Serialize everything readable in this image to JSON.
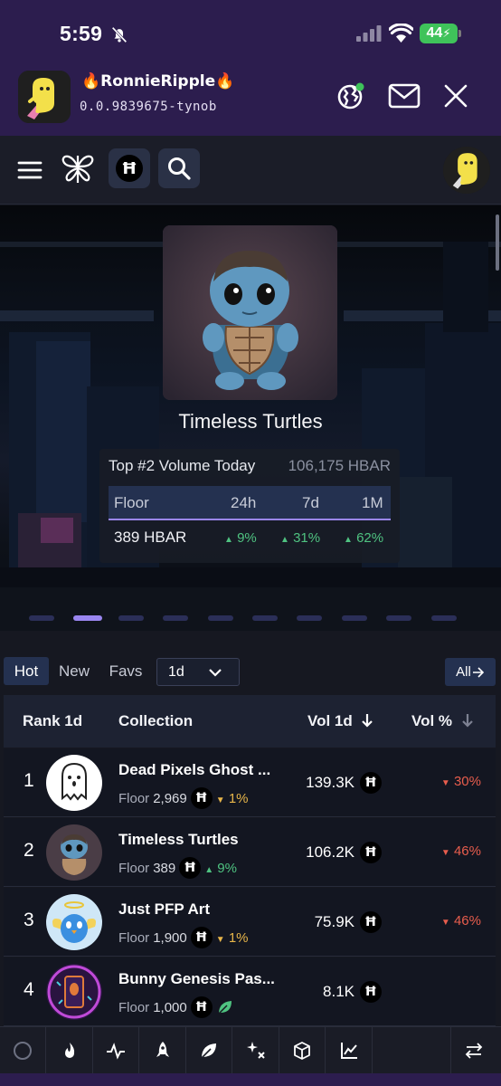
{
  "status": {
    "time": "5:59",
    "battery": "44"
  },
  "wallet": {
    "name": "RonnieRipple",
    "name_prefix": "🔥",
    "name_suffix": "🔥",
    "account_id": "0.0.9839675-tynob"
  },
  "toolbar": {
    "network_symbol": "Ħ"
  },
  "hero": {
    "collection_name": "Timeless Turtles",
    "rank_label": "Top #2 Volume Today",
    "volume": "106,175 HBAR",
    "headers": [
      "Floor",
      "24h",
      "7d",
      "1M"
    ],
    "floor": "389 HBAR",
    "changes": [
      "9%",
      "31%",
      "62%"
    ],
    "carousel_count": 10,
    "carousel_active_index": 1
  },
  "filters": {
    "tabs": [
      "Hot",
      "New",
      "Favs"
    ],
    "active_tab": "Hot",
    "period": "1d",
    "all_label": "All"
  },
  "table": {
    "headers": {
      "rank": "Rank 1d",
      "collection": "Collection",
      "vol": "Vol 1d",
      "vol_pct": "Vol %"
    },
    "floor_label": "Floor",
    "rows": [
      {
        "rank": "1",
        "name": "Dead Pixels Ghost ...",
        "floor": "2,969",
        "floor_change": "1%",
        "volume": "139.3K",
        "vol_pct": "30%"
      },
      {
        "rank": "2",
        "name": "Timeless Turtles",
        "floor": "389",
        "floor_change": "9%",
        "volume": "106.2K",
        "vol_pct": "46%"
      },
      {
        "rank": "3",
        "name": "Just PFP Art",
        "floor": "1,900",
        "floor_change": "1%",
        "volume": "75.9K",
        "vol_pct": "46%"
      },
      {
        "rank": "4",
        "name": "Bunny Genesis Pas...",
        "floor": "1,000",
        "floor_change": "",
        "volume": "8.1K",
        "vol_pct": ""
      }
    ]
  },
  "colors": {
    "accent": "#9a86f0",
    "down": "#e85d4d",
    "up_green": "#4fc381",
    "up_yellow": "#e8b64a",
    "header_bg": "#2c1d4e"
  },
  "bottom_nav_icons": [
    "circle-icon",
    "flame-icon",
    "activity-icon",
    "rocket-icon",
    "leaf-icon",
    "sparkles-icon",
    "cube-icon",
    "chart-icon",
    "swap-icon"
  ]
}
